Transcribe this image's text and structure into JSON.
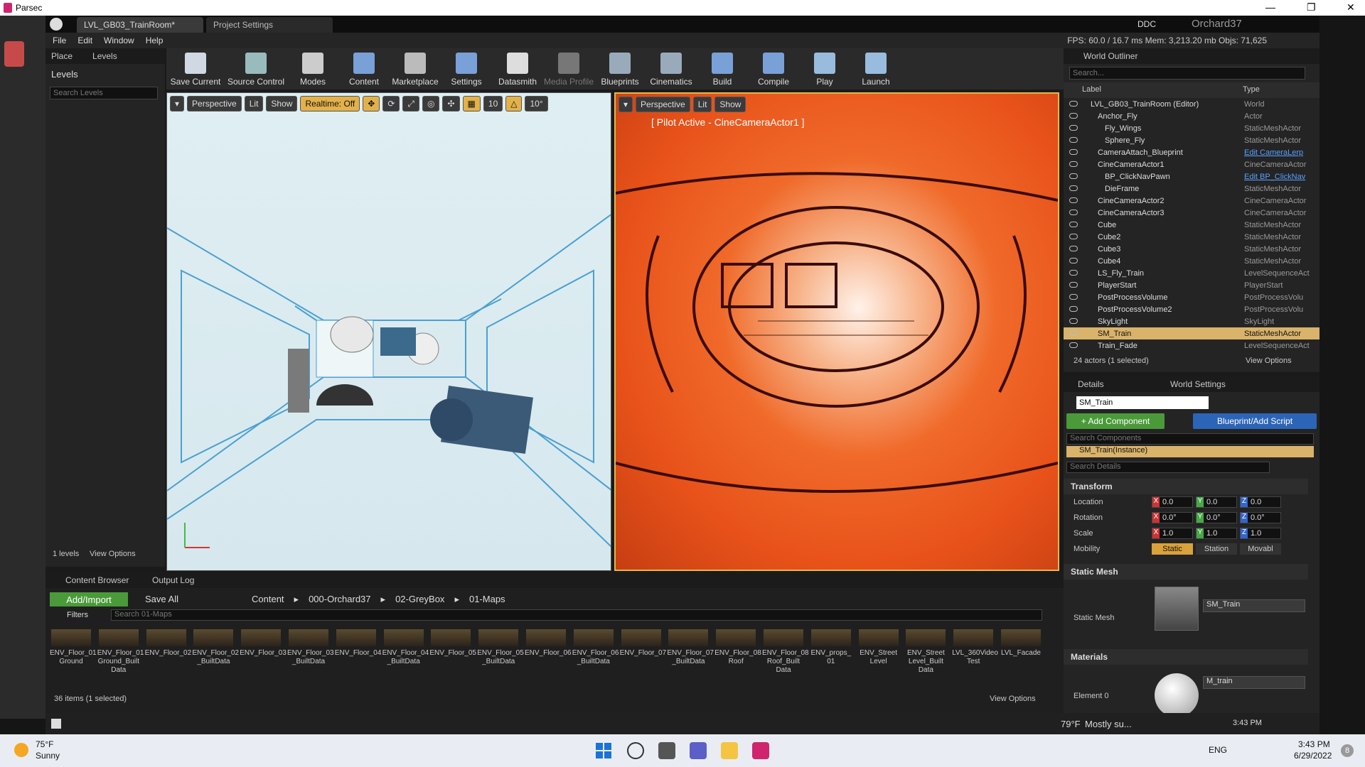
{
  "parsec": {
    "title": "Parsec",
    "minimize": "—",
    "restore": "❐",
    "close": "✕"
  },
  "tabs": {
    "level_tab": "LVL_GB03_TrainRoom*",
    "settings_tab": "Project Settings",
    "ddc": "DDC",
    "user": "Orchard37"
  },
  "menu": {
    "file": "File",
    "edit": "Edit",
    "window": "Window",
    "help": "Help"
  },
  "stats": "FPS: 60.0 / 16.7 ms  Mem: 3,213.20 mb  Objs: 71,625",
  "levels": {
    "place": "Place",
    "levels_tab": "Levels",
    "title": "Levels",
    "search": "Search Levels",
    "count": "1 levels",
    "view_options": "View Options"
  },
  "toolbar": [
    "Save Current",
    "Source Control",
    "Modes",
    "Content",
    "Marketplace",
    "Settings",
    "Datasmith",
    "Media Profile",
    "Blueprints",
    "Cinematics",
    "Build",
    "Compile",
    "Play",
    "Launch"
  ],
  "vp1": {
    "perspective": "Perspective",
    "lit": "Lit",
    "show": "Show",
    "realtime": "Realtime: Off",
    "grid": "10",
    "angle": "10°"
  },
  "vp2": {
    "perspective": "Perspective",
    "lit": "Lit",
    "show": "Show",
    "pilot": "[ Pilot Active - CineCameraActor1 ]"
  },
  "outliner": {
    "title": "World Outliner",
    "search": "Search...",
    "col_label": "Label",
    "col_type": "Type",
    "rows": [
      {
        "label": "LVL_GB03_TrainRoom (Editor)",
        "type": "World"
      },
      {
        "label": "Anchor_Fly",
        "type": "Actor"
      },
      {
        "label": "Fly_Wings",
        "type": "StaticMeshActor"
      },
      {
        "label": "Sphere_Fly",
        "type": "StaticMeshActor"
      },
      {
        "label": "CameraAttach_Blueprint",
        "type": "Edit CameraLerp"
      },
      {
        "label": "CineCameraActor1",
        "type": "CineCameraActor"
      },
      {
        "label": "BP_ClickNavPawn",
        "type": "Edit BP_ClickNav"
      },
      {
        "label": "DieFrame",
        "type": "StaticMeshActor"
      },
      {
        "label": "CineCameraActor2",
        "type": "CineCameraActor"
      },
      {
        "label": "CineCameraActor3",
        "type": "CineCameraActor"
      },
      {
        "label": "Cube",
        "type": "StaticMeshActor"
      },
      {
        "label": "Cube2",
        "type": "StaticMeshActor"
      },
      {
        "label": "Cube3",
        "type": "StaticMeshActor"
      },
      {
        "label": "Cube4",
        "type": "StaticMeshActor"
      },
      {
        "label": "LS_Fly_Train",
        "type": "LevelSequenceAct"
      },
      {
        "label": "PlayerStart",
        "type": "PlayerStart"
      },
      {
        "label": "PostProcessVolume",
        "type": "PostProcessVolu"
      },
      {
        "label": "PostProcessVolume2",
        "type": "PostProcessVolu"
      },
      {
        "label": "SkyLight",
        "type": "SkyLight"
      },
      {
        "label": "SM_Train",
        "type": "StaticMeshActor"
      },
      {
        "label": "Train_Fade",
        "type": "LevelSequenceAct"
      }
    ],
    "count": "24 actors (1 selected)",
    "view_options": "View Options"
  },
  "details": {
    "tab_details": "Details",
    "tab_world": "World Settings",
    "name": "SM_Train",
    "add_component": "+ Add Component",
    "blueprint": "Blueprint/Add Script",
    "search_components": "Search Components",
    "instance": "SM_Train(Instance)",
    "search_details": "Search Details",
    "transform": "Transform",
    "location": "Location",
    "rotation": "Rotation",
    "scale": "Scale",
    "mobility": "Mobility",
    "loc": [
      "0.0",
      "0.0",
      "0.0"
    ],
    "rot": [
      "0.0°",
      "0.0°",
      "0.0°"
    ],
    "scl": [
      "1.0",
      "1.0",
      "1.0"
    ],
    "mob": [
      "Static",
      "Station",
      "Movabl"
    ],
    "static_mesh_sec": "Static Mesh",
    "static_mesh": "Static Mesh",
    "mesh_value": "SM_Train",
    "materials_sec": "Materials",
    "element0": "Element 0",
    "material_value": "M_train"
  },
  "cb": {
    "tab_cb": "Content Browser",
    "tab_log": "Output Log",
    "add": "Add/Import",
    "save": "Save All",
    "path": [
      "Content",
      "000-Orchard37",
      "02-GreyBox",
      "01-Maps"
    ],
    "filters": "Filters",
    "search": "Search 01-Maps",
    "count": "36 items (1 selected)",
    "view_options": "View Options",
    "assets": [
      "ENV_Floor_01 Ground",
      "ENV_Floor_01 Ground_Built Data",
      "ENV_Floor_02",
      "ENV_Floor_02 _BuiltData",
      "ENV_Floor_03",
      "ENV_Floor_03 _BuiltData",
      "ENV_Floor_04",
      "ENV_Floor_04 _BuiltData",
      "ENV_Floor_05",
      "ENV_Floor_05 _BuiltData",
      "ENV_Floor_06",
      "ENV_Floor_06 _BuiltData",
      "ENV_Floor_07",
      "ENV_Floor_07 _BuiltData",
      "ENV_Floor_08 Roof",
      "ENV_Floor_08 Roof_Built Data",
      "ENV_props_ 01",
      "ENV_Street Level",
      "ENV_Street Level_Built Data",
      "LVL_360Video Test",
      "LVL_Facade"
    ]
  },
  "taskbar1": {
    "weather": "79°F",
    "weather_desc": "Mostly su...",
    "time": "3:43 PM",
    "date": "6/29/2022"
  },
  "taskbar2": {
    "temp": "75°F",
    "cond": "Sunny",
    "lang": "ENG",
    "time": "3:43 PM",
    "date": "6/29/2022",
    "badge": "8"
  }
}
